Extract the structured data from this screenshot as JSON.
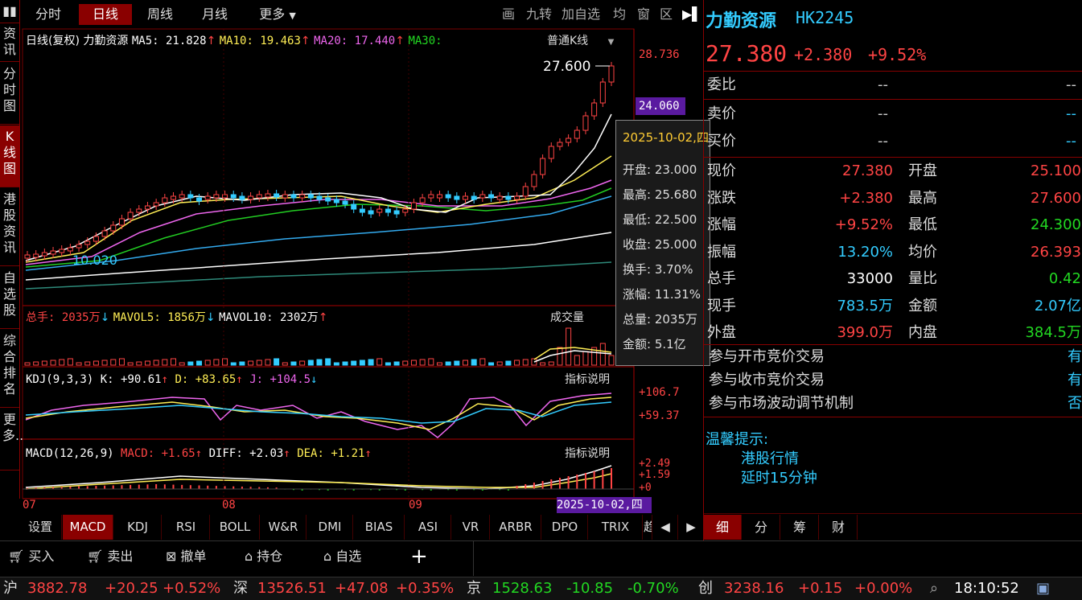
{
  "left_tabs": [
    "资讯",
    "分时图",
    "K线图",
    "港股资讯",
    "自选股",
    "综合排名",
    "更多.."
  ],
  "top_tabs": [
    "分时",
    "日线",
    "周线",
    "月线",
    "更多"
  ],
  "top_tools": [
    "画",
    "九转",
    "加自选",
    "均",
    "窗",
    "区"
  ],
  "chart": {
    "period_label": "日线(复权)",
    "stock_name": "力勤资源",
    "ma5": "MA5: 21.828",
    "ma10": "MA10: 19.463",
    "ma20": "MA20: 17.440",
    "ma30": "MA30:",
    "mode": "普通K线",
    "price_axis": [
      "28.736",
      "24.060"
    ],
    "high_marker": "27.600",
    "low_marker": "10.020",
    "vol_label": "总手: 2035万",
    "mavol5": "MAVOL5: 1856万",
    "mavol10": "MAVOL10: 2302万",
    "vol_title": "成交量",
    "kdj_label": "KDJ(9,3,3)",
    "kdj_k": "K: +90.61",
    "kdj_d": "D: +83.65",
    "kdj_j": "J: +104.5",
    "kdj_help": "指标说明",
    "kdj_axis": [
      "+106.7",
      "+59.37"
    ],
    "macd_label": "MACD(12,26,9)",
    "macd_val": "MACD: +1.65",
    "diff": "DIFF: +2.03",
    "dea": "DEA: +1.21",
    "macd_help": "指标说明",
    "macd_axis": [
      "+2.49",
      "+1.59",
      "+0"
    ],
    "months": [
      "07",
      "08",
      "09"
    ],
    "cursor_date": "2025-10-02,四"
  },
  "tooltip": {
    "date": "2025-10-02,四",
    "open": "开盘: 23.000",
    "high": "最高: 25.680",
    "low": "最低: 22.500",
    "close": "收盘: 25.000",
    "turnover": "换手: 3.70%",
    "change_pct": "涨幅: 11.31%",
    "volume": "总量: 2035万",
    "amount": "金额: 5.1亿"
  },
  "indicator_tabs": [
    "设置",
    "MACD",
    "KDJ",
    "RSI",
    "BOLL",
    "W&R",
    "DMI",
    "BIAS",
    "ASI",
    "VR",
    "ARBR",
    "DPO",
    "TRIX",
    "趋"
  ],
  "trade_bar": [
    "买入",
    "卖出",
    "撤单",
    "持仓",
    "自选"
  ],
  "status": {
    "sh_label": "沪",
    "sh_val": "3882.78",
    "sh_chg": "+20.25",
    "sh_pct": "+0.52%",
    "sz_label": "深",
    "sz_val": "13526.51",
    "sz_chg": "+47.08",
    "sz_pct": "+0.35%",
    "bj_label": "京",
    "bj_val": "1528.63",
    "bj_chg": "-10.85",
    "bj_pct": "-0.70%",
    "cy_label": "创",
    "cy_val": "3238.16",
    "cy_chg": "+0.15",
    "cy_pct": "+0.00%",
    "time": "18:10:52"
  },
  "quote": {
    "name": "力勤资源",
    "code": "HK2245",
    "price": "27.380",
    "change": "+2.380",
    "pct": "+9.52%",
    "weibi_label": "委比",
    "weibi_val": "--",
    "weibi_val2": "--",
    "sell_label": "卖价",
    "sell_val": "--",
    "sell_val2": "--",
    "buy_label": "买价",
    "buy_val": "--",
    "buy_val2": "--",
    "rows": [
      {
        "l": "现价",
        "v": "27.380",
        "l2": "开盘",
        "v2": "25.100"
      },
      {
        "l": "涨跌",
        "v": "+2.380",
        "l2": "最高",
        "v2": "27.600"
      },
      {
        "l": "涨幅",
        "v": "+9.52%",
        "l2": "最低",
        "v2": "24.300"
      },
      {
        "l": "振幅",
        "v": "13.20%",
        "l2": "均价",
        "v2": "26.393"
      },
      {
        "l": "总手",
        "v": "33000",
        "l2": "量比",
        "v2": "0.42"
      },
      {
        "l": "现手",
        "v": "783.5万",
        "l2": "金额",
        "v2": "2.07亿"
      },
      {
        "l": "外盘",
        "v": "399.0万",
        "l2": "内盘",
        "v2": "384.5万"
      }
    ],
    "flags": [
      {
        "l": "参与开市竞价交易",
        "v": "有"
      },
      {
        "l": "参与收市竞价交易",
        "v": "有"
      },
      {
        "l": "参与市场波动调节机制",
        "v": "否"
      }
    ],
    "tip_title": "温馨提示:",
    "tip_line1": "港股行情",
    "tip_line2": "延时15分钟"
  },
  "right_tabs": [
    "细",
    "分",
    "筹",
    "财"
  ],
  "colors": {
    "up": "#ff4444",
    "down": "#22d822",
    "accent": "#8a0000",
    "cyan": "#33ccff"
  }
}
